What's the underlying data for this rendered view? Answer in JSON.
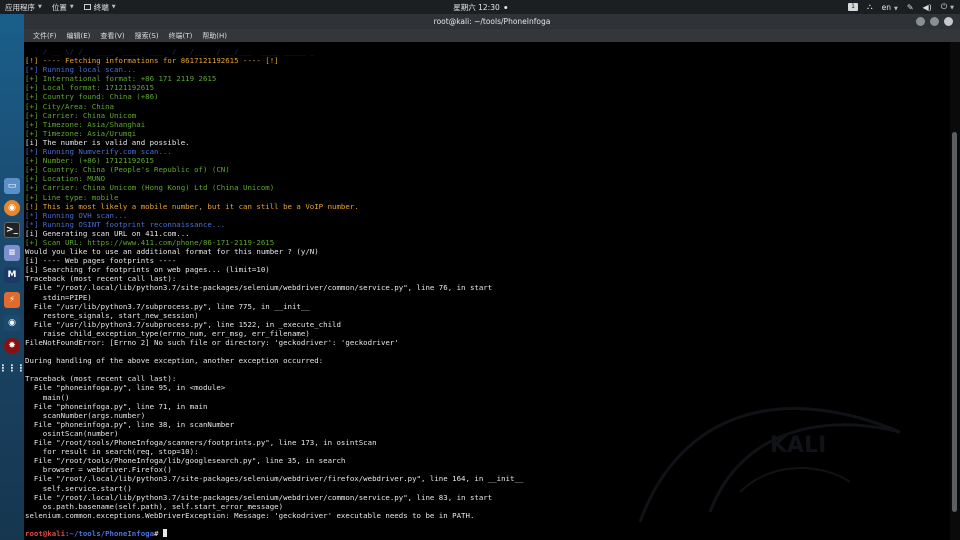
{
  "top_panel": {
    "applications": "应用程序",
    "places": "位置",
    "terminal": "终端",
    "clock": "星期六 12:30",
    "workspace": "1",
    "lang": "en"
  },
  "window": {
    "title": "root@kali: ~/tools/PhoneInfoga",
    "menu": [
      "文件(F)",
      "编辑(E)",
      "查看(V)",
      "搜索(S)",
      "终端(T)",
      "帮助(H)"
    ]
  },
  "dock_items": [
    "file-manager",
    "firefox",
    "terminal",
    "notes",
    "metasploit",
    "burpsuite",
    "maltego",
    "armitage",
    "show-apps"
  ],
  "terminal": {
    "banner": "    / __ \\/ /_  ____  ____  ___  /  _/___  / __/___  ____ _____ _",
    "lines": [
      {
        "t": "[!] ---- Fetching informations for 8617121192615 ---- [!]",
        "c": "orange"
      },
      {
        "t": "[*] Running local scan...",
        "c": "blue"
      },
      {
        "t": "[+] International format: +86 171 2119 2615",
        "c": "green"
      },
      {
        "t": "[+] Local format: 17121192615",
        "c": "green"
      },
      {
        "t": "[+] Country found: China (+86)",
        "c": "green"
      },
      {
        "t": "[+] City/Area: China",
        "c": "green"
      },
      {
        "t": "[+] Carrier: China Unicom",
        "c": "green"
      },
      {
        "t": "[+] Timezone: Asia/Shanghai",
        "c": "green"
      },
      {
        "t": "[+] Timezone: Asia/Urumqi",
        "c": "green"
      },
      {
        "t": "[i] The number is valid and possible.",
        "c": "white"
      },
      {
        "t": "[*] Running Numverify.com scan...",
        "c": "blue"
      },
      {
        "t": "[+] Number: (+86) 17121192615",
        "c": "green"
      },
      {
        "t": "[+] Country: China (People's Republic of) (CN)",
        "c": "green"
      },
      {
        "t": "[+] Location: MUNO",
        "c": "green"
      },
      {
        "t": "[+] Carrier: China Unicom (Hong Kong) Ltd (China Unicom)",
        "c": "green"
      },
      {
        "t": "[+] Line type: mobile",
        "c": "green"
      },
      {
        "t": "[!] This is most likely a mobile number, but it can still be a VoIP number.",
        "c": "orange"
      },
      {
        "t": "[*] Running OVH scan...",
        "c": "blue"
      },
      {
        "t": "[*] Running OSINT footprint reconnaissance...",
        "c": "blue"
      },
      {
        "t": "[i] Generating scan URL on 411.com...",
        "c": "white"
      },
      {
        "t": "[+] Scan URL: https://www.411.com/phone/86-171-2119-2615",
        "c": "green"
      },
      {
        "t": "Would you like to use an additional format for this number ? (y/N)",
        "c": "white"
      },
      {
        "t": "[i] ---- Web pages footprints ----",
        "c": "white"
      },
      {
        "t": "[i] Searching for footprints on web pages... (limit=10)",
        "c": "white"
      },
      {
        "t": "Traceback (most recent call last):",
        "c": "white"
      },
      {
        "t": "  File \"/root/.local/lib/python3.7/site-packages/selenium/webdriver/common/service.py\", line 76, in start",
        "c": "white"
      },
      {
        "t": "    stdin=PIPE)",
        "c": "white"
      },
      {
        "t": "  File \"/usr/lib/python3.7/subprocess.py\", line 775, in __init__",
        "c": "white"
      },
      {
        "t": "    restore_signals, start_new_session)",
        "c": "white"
      },
      {
        "t": "  File \"/usr/lib/python3.7/subprocess.py\", line 1522, in _execute_child",
        "c": "white"
      },
      {
        "t": "    raise child_exception_type(errno_num, err_msg, err_filename)",
        "c": "white"
      },
      {
        "t": "FileNotFoundError: [Errno 2] No such file or directory: 'geckodriver': 'geckodriver'",
        "c": "white"
      },
      {
        "t": "",
        "c": "white"
      },
      {
        "t": "During handling of the above exception, another exception occurred:",
        "c": "white"
      },
      {
        "t": "",
        "c": "white"
      },
      {
        "t": "Traceback (most recent call last):",
        "c": "white"
      },
      {
        "t": "  File \"phoneinfoga.py\", line 95, in <module>",
        "c": "white"
      },
      {
        "t": "    main()",
        "c": "white"
      },
      {
        "t": "  File \"phoneinfoga.py\", line 71, in main",
        "c": "white"
      },
      {
        "t": "    scanNumber(args.number)",
        "c": "white"
      },
      {
        "t": "  File \"phoneinfoga.py\", line 38, in scanNumber",
        "c": "white"
      },
      {
        "t": "    osintScan(number)",
        "c": "white"
      },
      {
        "t": "  File \"/root/tools/PhoneInfoga/scanners/footprints.py\", line 173, in osintScan",
        "c": "white"
      },
      {
        "t": "    for result in search(req, stop=10):",
        "c": "white"
      },
      {
        "t": "  File \"/root/tools/PhoneInfoga/lib/googlesearch.py\", line 35, in search",
        "c": "white"
      },
      {
        "t": "    browser = webdriver.Firefox()",
        "c": "white"
      },
      {
        "t": "  File \"/root/.local/lib/python3.7/site-packages/selenium/webdriver/firefox/webdriver.py\", line 164, in __init__",
        "c": "white"
      },
      {
        "t": "    self.service.start()",
        "c": "white"
      },
      {
        "t": "  File \"/root/.local/lib/python3.7/site-packages/selenium/webdriver/common/service.py\", line 83, in start",
        "c": "white"
      },
      {
        "t": "    os.path.basename(self.path), self.start_error_message)",
        "c": "white"
      },
      {
        "t": "selenium.common.exceptions.WebDriverException: Message: 'geckodriver' executable needs to be in PATH.",
        "c": "white"
      },
      {
        "t": "",
        "c": "white"
      }
    ],
    "prompt_user": "root@kali",
    "prompt_path": ":~/tools/PhoneInfoga",
    "prompt_symbol": "#"
  },
  "watermark_text": "KALI"
}
